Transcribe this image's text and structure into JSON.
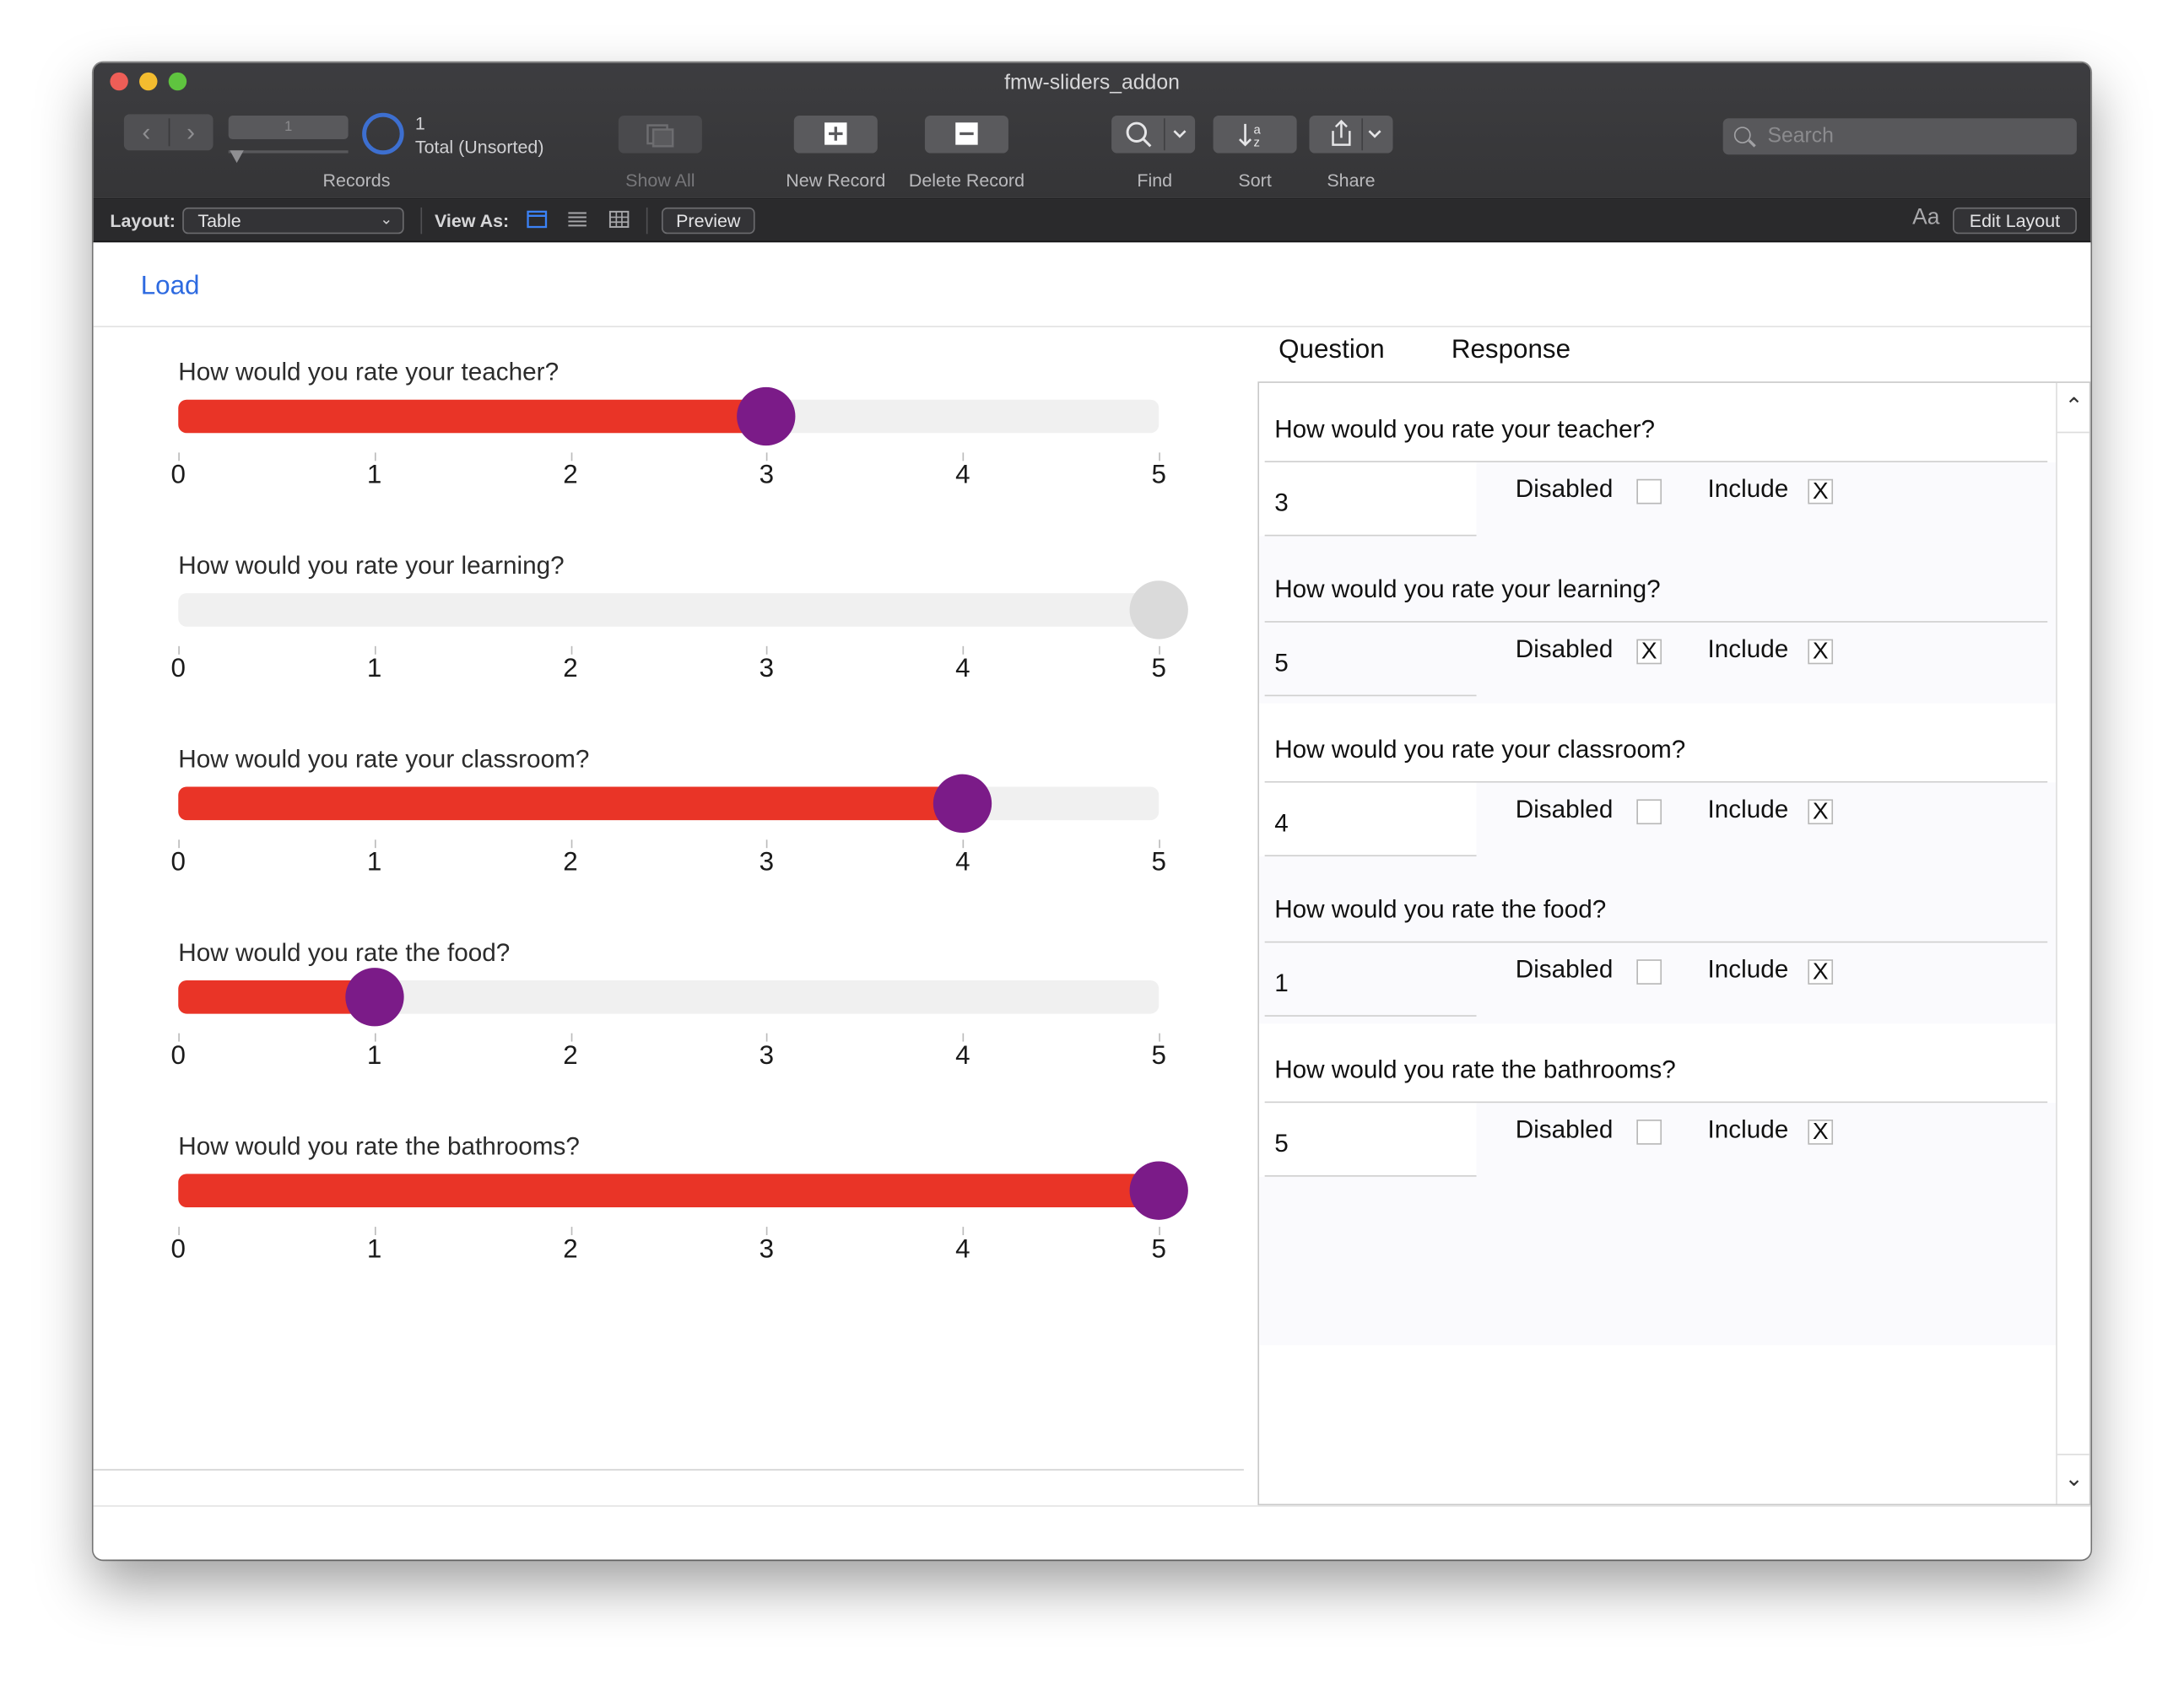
{
  "window": {
    "title": "fmw-sliders_addon"
  },
  "toolbar": {
    "record_number": "1",
    "record_count": "1",
    "total_label": "Total (Unsorted)",
    "records_label": "Records",
    "show_all_label": "Show All",
    "new_record_label": "New Record",
    "delete_record_label": "Delete Record",
    "find_label": "Find",
    "sort_label": "Sort",
    "share_label": "Share",
    "search_placeholder": "Search"
  },
  "layout_bar": {
    "layout_label": "Layout:",
    "layout_value": "Table",
    "view_as_label": "View As:",
    "preview_label": "Preview",
    "font_icon_text": "Aa",
    "edit_layout_label": "Edit Layout"
  },
  "content": {
    "load_label": "Load"
  },
  "scale": {
    "min": 0,
    "max": 5,
    "tick_labels": [
      "0",
      "1",
      "2",
      "3",
      "4",
      "5"
    ]
  },
  "sliders": [
    {
      "question": "How would you rate your teacher?",
      "value": 3,
      "disabled": false
    },
    {
      "question": "How would you rate your learning?",
      "value": 5,
      "disabled": true
    },
    {
      "question": "How would you rate your classroom?",
      "value": 4,
      "disabled": false
    },
    {
      "question": "How would you rate the food?",
      "value": 1,
      "disabled": false
    },
    {
      "question": "How would you rate the bathrooms?",
      "value": 5,
      "disabled": false
    }
  ],
  "colors": {
    "fill": "#e93427",
    "thumb": "#7b1b88",
    "thumb_disabled": "#dadada",
    "track": "#f0f0f0",
    "link": "#2d6ae0"
  },
  "portal": {
    "question_header": "Question",
    "response_header": "Response",
    "disabled_label": "Disabled",
    "include_label": "Include",
    "checked_mark": "X",
    "rows": [
      {
        "question": "How would you rate your teacher?",
        "response": "3",
        "disabled": false,
        "include": true
      },
      {
        "question": "How would you rate your learning?",
        "response": "5",
        "disabled": true,
        "include": true
      },
      {
        "question": "How would you rate your classroom?",
        "response": "4",
        "disabled": false,
        "include": true
      },
      {
        "question": "How would you rate the food?",
        "response": "1",
        "disabled": false,
        "include": true
      },
      {
        "question": "How would you rate the bathrooms?",
        "response": "5",
        "disabled": false,
        "include": true
      }
    ]
  }
}
